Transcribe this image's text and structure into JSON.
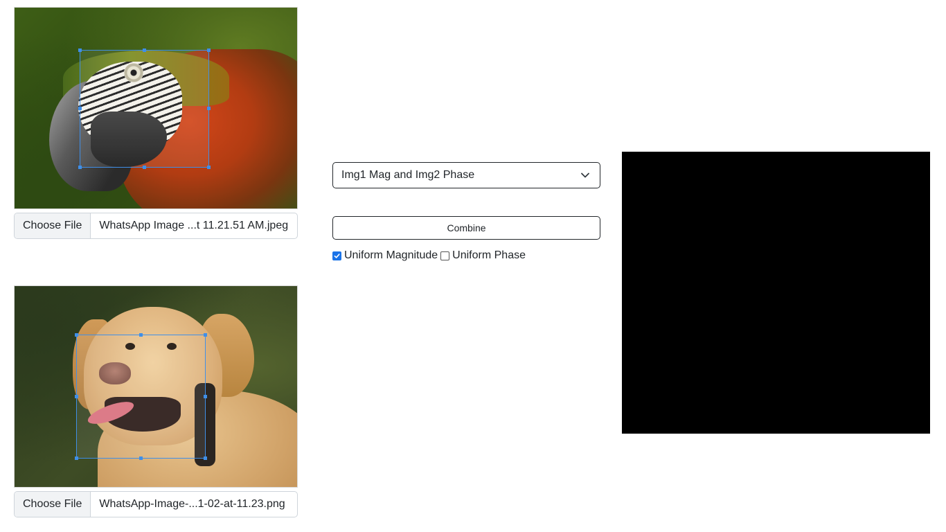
{
  "image1": {
    "file_button_label": "Choose File",
    "file_name": "WhatsApp Image ...t 11.21.51 AM.jpeg"
  },
  "image2": {
    "file_button_label": "Choose File",
    "file_name": "WhatsApp-Image-...1-02-at-11.23.png"
  },
  "controls": {
    "mode_selected": "Img1 Mag and Img2 Phase",
    "combine_label": "Combine",
    "uniform_magnitude": {
      "label": "Uniform Magnitude",
      "checked": true
    },
    "uniform_phase": {
      "label": "Uniform Phase",
      "checked": false
    }
  },
  "colors": {
    "crop_border": "#3f8fe8",
    "checkbox_accent": "#1a73e8",
    "output_background": "#000000"
  },
  "icons": {
    "select_arrow": "chevron-down-icon",
    "checkmark": "check-icon"
  }
}
